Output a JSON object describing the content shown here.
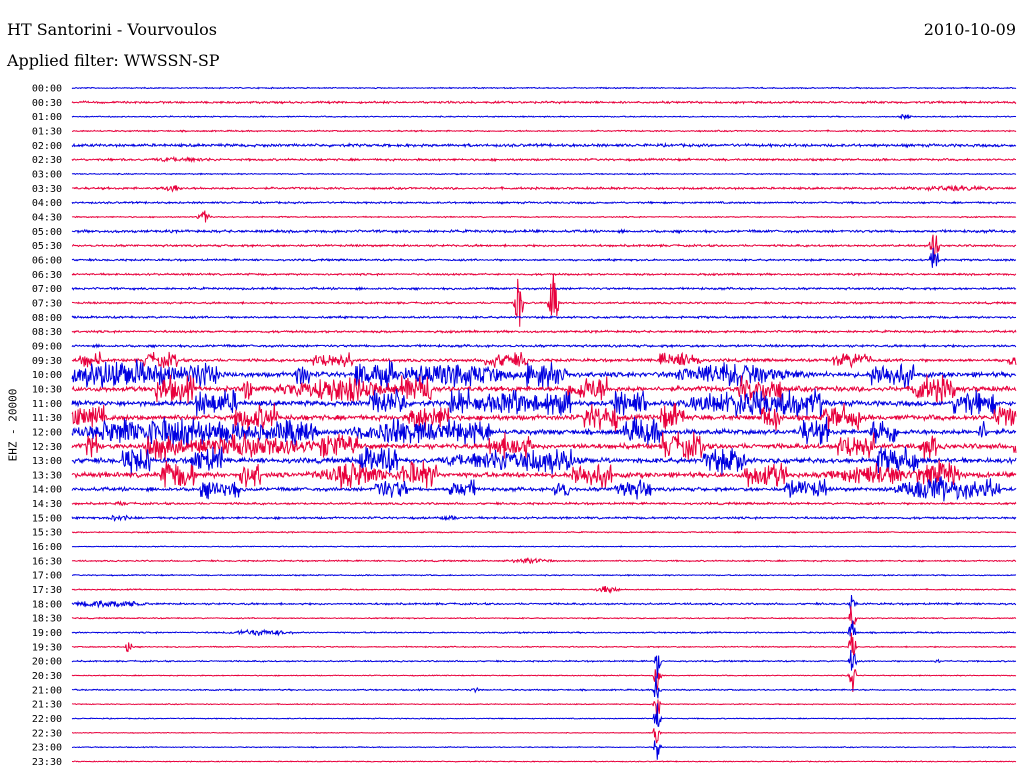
{
  "header": {
    "station": "HT Santorini - Vourvoulos",
    "date": "2010-10-09",
    "filter": "Applied filter: WWSSN-SP"
  },
  "colors": {
    "even_row": "#0000e0",
    "odd_row": "#e8003c"
  },
  "chart_data": {
    "type": "line",
    "title": "HT Santorini - Vourvoulos",
    "subtitle": "Applied filter: WWSSN-SP",
    "ylabel": "EHZ - 20000",
    "xlabel": "",
    "row_labels": [
      "00:00",
      "00:30",
      "01:00",
      "01:30",
      "02:00",
      "02:30",
      "03:00",
      "03:30",
      "04:00",
      "04:30",
      "05:00",
      "05:30",
      "06:00",
      "06:30",
      "07:00",
      "07:30",
      "08:00",
      "08:30",
      "09:00",
      "09:30",
      "10:00",
      "10:30",
      "11:00",
      "11:30",
      "12:00",
      "12:30",
      "13:00",
      "13:30",
      "14:00",
      "14:30",
      "15:00",
      "15:30",
      "16:00",
      "16:30",
      "17:00",
      "17:30",
      "18:00",
      "18:30",
      "19:00",
      "19:30",
      "20:00",
      "20:30",
      "21:00",
      "21:30",
      "22:00",
      "22:30",
      "23:00",
      "23:30"
    ],
    "row_minutes": 30,
    "base_noise": [
      0.5,
      0.9,
      0.5,
      0.6,
      1.2,
      0.9,
      0.5,
      0.9,
      0.8,
      0.5,
      1.1,
      0.9,
      0.8,
      0.8,
      0.9,
      0.8,
      0.9,
      0.9,
      1.0,
      2.0,
      3.5,
      3.5,
      3.5,
      3.5,
      3.5,
      3.5,
      3.5,
      3.5,
      2.5,
      0.9,
      0.9,
      0.5,
      0.4,
      0.6,
      0.5,
      0.5,
      0.8,
      0.5,
      0.6,
      0.5,
      0.6,
      0.4,
      0.6,
      0.4,
      0.4,
      0.3,
      0.4,
      0.4
    ],
    "events": [
      {
        "row": 2,
        "minute": 26.5,
        "amplitude": 4,
        "duration": 0.3
      },
      {
        "row": 5,
        "minute": 3.5,
        "amplitude": 3,
        "duration": 2.0
      },
      {
        "row": 7,
        "minute": 3.2,
        "amplitude": 6,
        "duration": 0.4
      },
      {
        "row": 7,
        "minute": 28.0,
        "amplitude": 3,
        "duration": 3.0
      },
      {
        "row": 9,
        "minute": 4.2,
        "amplitude": 8,
        "duration": 0.3
      },
      {
        "row": 11,
        "minute": 27.4,
        "amplitude": 22,
        "duration": 0.2
      },
      {
        "row": 12,
        "minute": 27.4,
        "amplitude": 18,
        "duration": 0.2
      },
      {
        "row": 15,
        "minute": 14.2,
        "amplitude": 35,
        "duration": 0.2
      },
      {
        "row": 15,
        "minute": 15.3,
        "amplitude": 40,
        "duration": 0.2
      },
      {
        "row": 20,
        "minute": 1.5,
        "amplitude": 18,
        "duration": 4.0
      },
      {
        "row": 20,
        "minute": 12.0,
        "amplitude": 16,
        "duration": 3.0
      },
      {
        "row": 20,
        "minute": 21.0,
        "amplitude": 14,
        "duration": 3.0
      },
      {
        "row": 21,
        "minute": 8.5,
        "amplitude": 14,
        "duration": 3.0
      },
      {
        "row": 22,
        "minute": 14.0,
        "amplitude": 16,
        "duration": 2.0
      },
      {
        "row": 22,
        "minute": 21.5,
        "amplitude": 18,
        "duration": 3.0
      },
      {
        "row": 24,
        "minute": 3.5,
        "amplitude": 18,
        "duration": 5.0
      },
      {
        "row": 24,
        "minute": 10.5,
        "amplitude": 16,
        "duration": 2.5
      },
      {
        "row": 25,
        "minute": 5.5,
        "amplitude": 14,
        "duration": 4.0
      },
      {
        "row": 26,
        "minute": 14.0,
        "amplitude": 16,
        "duration": 3.0
      },
      {
        "row": 27,
        "minute": 9.0,
        "amplitude": 14,
        "duration": 2.0
      },
      {
        "row": 27,
        "minute": 25.5,
        "amplitude": 14,
        "duration": 2.0
      },
      {
        "row": 28,
        "minute": 27.5,
        "amplitude": 16,
        "duration": 2.0
      },
      {
        "row": 29,
        "minute": 1.5,
        "amplitude": 3,
        "duration": 0.3
      },
      {
        "row": 30,
        "minute": 1.5,
        "amplitude": 5,
        "duration": 0.5
      },
      {
        "row": 30,
        "minute": 12.0,
        "amplitude": 3,
        "duration": 0.6
      },
      {
        "row": 33,
        "minute": 14.5,
        "amplitude": 4,
        "duration": 1.0
      },
      {
        "row": 35,
        "minute": 17.0,
        "amplitude": 6,
        "duration": 0.5
      },
      {
        "row": 36,
        "minute": 1.2,
        "amplitude": 6,
        "duration": 1.5
      },
      {
        "row": 36,
        "minute": 24.8,
        "amplitude": 14,
        "duration": 0.15
      },
      {
        "row": 37,
        "minute": 24.8,
        "amplitude": 22,
        "duration": 0.15
      },
      {
        "row": 38,
        "minute": 6.0,
        "amplitude": 4,
        "duration": 1.5
      },
      {
        "row": 38,
        "minute": 24.8,
        "amplitude": 22,
        "duration": 0.15
      },
      {
        "row": 39,
        "minute": 1.8,
        "amplitude": 14,
        "duration": 0.12
      },
      {
        "row": 39,
        "minute": 24.8,
        "amplitude": 22,
        "duration": 0.15
      },
      {
        "row": 40,
        "minute": 18.6,
        "amplitude": 22,
        "duration": 0.15
      },
      {
        "row": 40,
        "minute": 24.8,
        "amplitude": 22,
        "duration": 0.15
      },
      {
        "row": 40,
        "minute": 27.5,
        "amplitude": 3,
        "duration": 0.2
      },
      {
        "row": 41,
        "minute": 18.6,
        "amplitude": 22,
        "duration": 0.15
      },
      {
        "row": 41,
        "minute": 24.8,
        "amplitude": 22,
        "duration": 0.15
      },
      {
        "row": 42,
        "minute": 12.8,
        "amplitude": 4,
        "duration": 0.2
      },
      {
        "row": 42,
        "minute": 18.6,
        "amplitude": 22,
        "duration": 0.15
      },
      {
        "row": 43,
        "minute": 18.6,
        "amplitude": 22,
        "duration": 0.15
      },
      {
        "row": 44,
        "minute": 18.6,
        "amplitude": 22,
        "duration": 0.15
      },
      {
        "row": 45,
        "minute": 18.6,
        "amplitude": 22,
        "duration": 0.15
      },
      {
        "row": 46,
        "minute": 18.6,
        "amplitude": 22,
        "duration": 0.15
      }
    ],
    "grid": false,
    "legend": "none"
  }
}
